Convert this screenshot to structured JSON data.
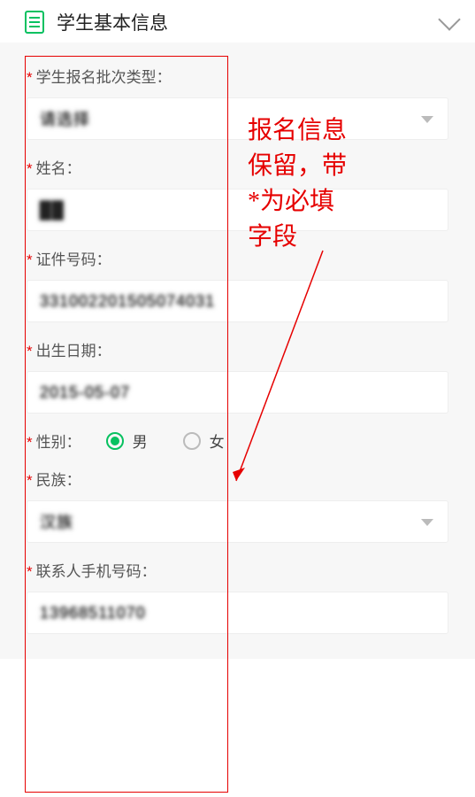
{
  "header": {
    "title": "学生基本信息"
  },
  "annotation": {
    "text": "报名信息\n保留，带\n*为必填\n字段"
  },
  "fields": {
    "batch": {
      "label": "学生报名批次类型：",
      "value": "请选择"
    },
    "name": {
      "label": "姓名：",
      "value": "██"
    },
    "idno": {
      "label": "证件号码：",
      "value": "331002201505074031"
    },
    "dob": {
      "label": "出生日期：",
      "value": "2015-05-07"
    },
    "gender": {
      "label": "性别：",
      "male": "男",
      "female": "女"
    },
    "ethnic": {
      "label": "民族：",
      "value": "汉族"
    },
    "phone": {
      "label": "联系人手机号码：",
      "value": "13968511070"
    }
  }
}
